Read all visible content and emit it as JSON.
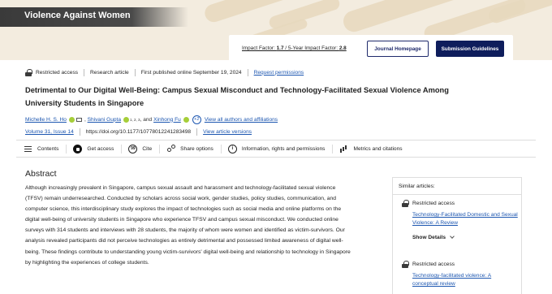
{
  "journal": {
    "title": "Violence Against Women",
    "impact_prefix": "Impact Factor: ",
    "impact_factor": "1.7",
    "impact_sep": " / 5-Year Impact Factor: ",
    "five_year_impact_factor": "2.8",
    "homepage_label": "Journal Homepage",
    "submission_label": "Submission Guidelines"
  },
  "meta": {
    "access": "Restricted access",
    "article_type": "Research article",
    "published": "First published online September 19, 2024",
    "permissions_label": "Request permissions"
  },
  "article": {
    "title": "Detrimental to Our Digital Well-Being: Campus Sexual Misconduct and Technology-Facilitated Sexual Violence Among University Students in Singapore",
    "authors": [
      {
        "name": "Michelle H. S. Ho"
      },
      {
        "name": "Shivani Gupta",
        "sup": "1, 2, 3"
      },
      {
        "name": "Xinhong Fu"
      }
    ],
    "and_text": "and",
    "more_authors": "+2",
    "all_authors_label": "View all authors and affiliations",
    "volume_issue": "Volume 31, Issue 14",
    "doi": "https://doi.org/10.1177/10778012241283498",
    "versions_label": "View article versions"
  },
  "toolbar": [
    {
      "label": "Contents",
      "icon": "contents-icon"
    },
    {
      "label": "Get access",
      "icon": "get-access-icon"
    },
    {
      "label": "Cite",
      "icon": "cite-icon",
      "glyph": "99"
    },
    {
      "label": "Share options",
      "icon": "share-icon"
    },
    {
      "label": "Information, rights and permissions",
      "icon": "info-icon",
      "glyph": "i"
    },
    {
      "label": "Metrics and citations",
      "icon": "metrics-icon"
    }
  ],
  "abstract": {
    "heading": "Abstract",
    "text": "Although increasingly prevalent in Singapore, campus sexual assault and harassment and technology-facilitated sexual violence (TFSV) remain underresearched. Conducted by scholars across social work, gender studies, policy studies, communication, and computer science, this interdisciplinary study explores the impact of technologies such as social media and online platforms on the digital well-being of university students in Singapore who experience TFSV and campus sexual misconduct. We conducted online surveys with 314 students and interviews with 28 students, the majority of whom were women and identified as victim-survivors. Our analysis revealed participants did not perceive technologies as entirely detrimental and possessed limited awareness of digital well-being. These findings contribute to understanding young victim-survivors' digital well-being and relationship to technology in Singapore by highlighting the experiences of college students."
  },
  "sidebar": {
    "title": "Similar articles:",
    "items": [
      {
        "access": "Restricted access",
        "title": "Technology-Facilitated Domestic and Sexual Violence: A Review",
        "details_label": "Show Details"
      },
      {
        "access": "Restricted access",
        "title": "Technology-facilitated violence: A conceptual review"
      }
    ]
  }
}
